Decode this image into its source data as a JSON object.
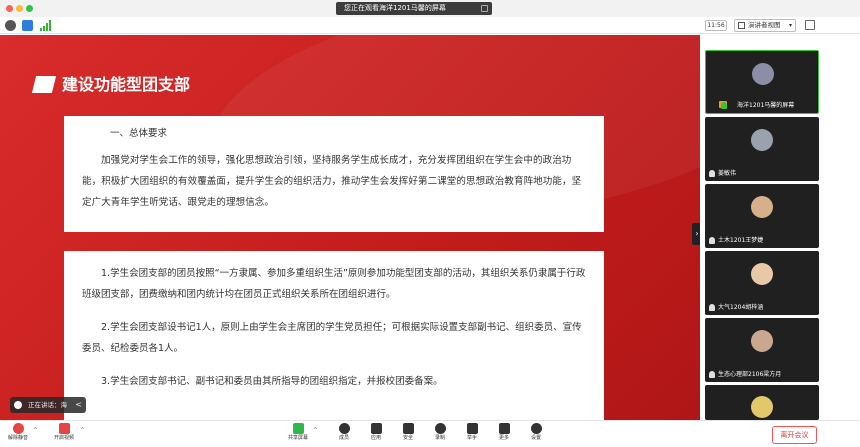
{
  "titlebar": {
    "banner": "您正在观看海洋1201马馨的屏幕"
  },
  "statusbar": {
    "time": "11:56",
    "view_label": "演讲者视图",
    "view_chevron": "▾"
  },
  "slide": {
    "title": "建设功能型团支部",
    "card1": {
      "heading": "一、总体要求",
      "paragraph": "加强党对学生会工作的领导，强化思想政治引领，坚持服务学生成长成才，充分发挥团组织在学生会中的政治功能，积极扩大团组织的有效覆盖面，提升学生会的组织活力，推动学生会发挥好第二课堂的思想政治教育阵地功能，坚定广大青年学生听党话、跟党走的理想信念。"
    },
    "card2": {
      "items": [
        "1.学生会团支部的团员按照“一方隶属、参加多重组织生活”原则参加功能型团支部的活动，其组织关系仍隶属于行政班级团支部，团费缴纳和团内统计均在团员正式组织关系所在团组织进行。",
        "2.学生会团支部设书记1人，原则上由学生会主席团的学生党员担任；可根据实际设置支部副书记、组织委员、宣传委员、纪检委员各1人。",
        "3.学生会团支部书记、副书记和委员由其所指导的团组织指定，并报校团委备案。"
      ]
    },
    "speaking": "正在讲话：海",
    "speaking_chevron": "<",
    "collapse_glyph": "›"
  },
  "participants": [
    {
      "name": "海洋1201马馨的屏幕",
      "avatar_color": "#8a8fa6",
      "host": true,
      "active": true
    },
    {
      "name": "姜敏伟",
      "avatar_color": "#9aa3ad",
      "host": false,
      "active": false
    },
    {
      "name": "土木1201王梦婕",
      "avatar_color": "#d6b08a",
      "host": false,
      "active": false
    },
    {
      "name": "大气1204胡梓涵",
      "avatar_color": "#e7c9a8",
      "host": false,
      "active": false
    },
    {
      "name": "生态心理部2106梁方月",
      "avatar_color": "#c9a88f",
      "host": false,
      "active": false
    },
    {
      "name": "",
      "avatar_color": "#e2c86a",
      "host": false,
      "active": false
    }
  ],
  "toolbar": {
    "mute": "解除静音",
    "video": "开启视频",
    "share": "共享屏幕",
    "members": "成员",
    "apps": "应用",
    "security": "安全",
    "record": "录制",
    "hand": "举手",
    "more": "更多",
    "settings": "设置",
    "leave": "离开会议",
    "caret": "^"
  },
  "colors": {
    "slide_red": "#c41d1d",
    "active_border": "#35c235",
    "leave_red": "#e53b3b"
  }
}
